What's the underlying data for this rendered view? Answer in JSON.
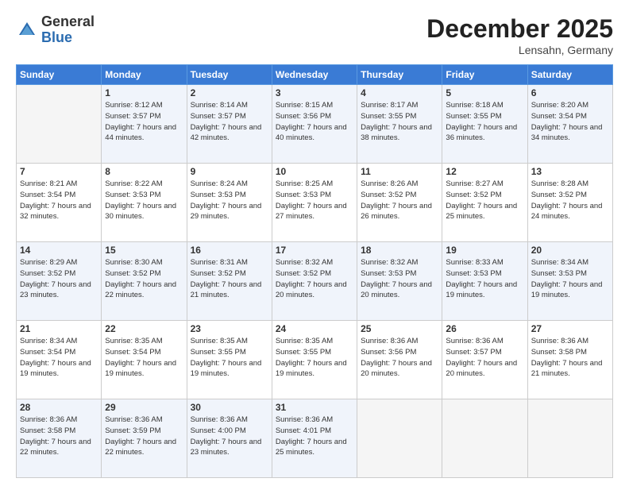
{
  "header": {
    "logo_general": "General",
    "logo_blue": "Blue",
    "month_title": "December 2025",
    "subtitle": "Lensahn, Germany"
  },
  "days_of_week": [
    "Sunday",
    "Monday",
    "Tuesday",
    "Wednesday",
    "Thursday",
    "Friday",
    "Saturday"
  ],
  "weeks": [
    [
      {
        "day": "",
        "info": ""
      },
      {
        "day": "1",
        "info": "Sunrise: 8:12 AM\nSunset: 3:57 PM\nDaylight: 7 hours\nand 44 minutes."
      },
      {
        "day": "2",
        "info": "Sunrise: 8:14 AM\nSunset: 3:57 PM\nDaylight: 7 hours\nand 42 minutes."
      },
      {
        "day": "3",
        "info": "Sunrise: 8:15 AM\nSunset: 3:56 PM\nDaylight: 7 hours\nand 40 minutes."
      },
      {
        "day": "4",
        "info": "Sunrise: 8:17 AM\nSunset: 3:55 PM\nDaylight: 7 hours\nand 38 minutes."
      },
      {
        "day": "5",
        "info": "Sunrise: 8:18 AM\nSunset: 3:55 PM\nDaylight: 7 hours\nand 36 minutes."
      },
      {
        "day": "6",
        "info": "Sunrise: 8:20 AM\nSunset: 3:54 PM\nDaylight: 7 hours\nand 34 minutes."
      }
    ],
    [
      {
        "day": "7",
        "info": "Sunrise: 8:21 AM\nSunset: 3:54 PM\nDaylight: 7 hours\nand 32 minutes."
      },
      {
        "day": "8",
        "info": "Sunrise: 8:22 AM\nSunset: 3:53 PM\nDaylight: 7 hours\nand 30 minutes."
      },
      {
        "day": "9",
        "info": "Sunrise: 8:24 AM\nSunset: 3:53 PM\nDaylight: 7 hours\nand 29 minutes."
      },
      {
        "day": "10",
        "info": "Sunrise: 8:25 AM\nSunset: 3:53 PM\nDaylight: 7 hours\nand 27 minutes."
      },
      {
        "day": "11",
        "info": "Sunrise: 8:26 AM\nSunset: 3:52 PM\nDaylight: 7 hours\nand 26 minutes."
      },
      {
        "day": "12",
        "info": "Sunrise: 8:27 AM\nSunset: 3:52 PM\nDaylight: 7 hours\nand 25 minutes."
      },
      {
        "day": "13",
        "info": "Sunrise: 8:28 AM\nSunset: 3:52 PM\nDaylight: 7 hours\nand 24 minutes."
      }
    ],
    [
      {
        "day": "14",
        "info": "Sunrise: 8:29 AM\nSunset: 3:52 PM\nDaylight: 7 hours\nand 23 minutes."
      },
      {
        "day": "15",
        "info": "Sunrise: 8:30 AM\nSunset: 3:52 PM\nDaylight: 7 hours\nand 22 minutes."
      },
      {
        "day": "16",
        "info": "Sunrise: 8:31 AM\nSunset: 3:52 PM\nDaylight: 7 hours\nand 21 minutes."
      },
      {
        "day": "17",
        "info": "Sunrise: 8:32 AM\nSunset: 3:52 PM\nDaylight: 7 hours\nand 20 minutes."
      },
      {
        "day": "18",
        "info": "Sunrise: 8:32 AM\nSunset: 3:53 PM\nDaylight: 7 hours\nand 20 minutes."
      },
      {
        "day": "19",
        "info": "Sunrise: 8:33 AM\nSunset: 3:53 PM\nDaylight: 7 hours\nand 19 minutes."
      },
      {
        "day": "20",
        "info": "Sunrise: 8:34 AM\nSunset: 3:53 PM\nDaylight: 7 hours\nand 19 minutes."
      }
    ],
    [
      {
        "day": "21",
        "info": "Sunrise: 8:34 AM\nSunset: 3:54 PM\nDaylight: 7 hours\nand 19 minutes."
      },
      {
        "day": "22",
        "info": "Sunrise: 8:35 AM\nSunset: 3:54 PM\nDaylight: 7 hours\nand 19 minutes."
      },
      {
        "day": "23",
        "info": "Sunrise: 8:35 AM\nSunset: 3:55 PM\nDaylight: 7 hours\nand 19 minutes."
      },
      {
        "day": "24",
        "info": "Sunrise: 8:35 AM\nSunset: 3:55 PM\nDaylight: 7 hours\nand 19 minutes."
      },
      {
        "day": "25",
        "info": "Sunrise: 8:36 AM\nSunset: 3:56 PM\nDaylight: 7 hours\nand 20 minutes."
      },
      {
        "day": "26",
        "info": "Sunrise: 8:36 AM\nSunset: 3:57 PM\nDaylight: 7 hours\nand 20 minutes."
      },
      {
        "day": "27",
        "info": "Sunrise: 8:36 AM\nSunset: 3:58 PM\nDaylight: 7 hours\nand 21 minutes."
      }
    ],
    [
      {
        "day": "28",
        "info": "Sunrise: 8:36 AM\nSunset: 3:58 PM\nDaylight: 7 hours\nand 22 minutes."
      },
      {
        "day": "29",
        "info": "Sunrise: 8:36 AM\nSunset: 3:59 PM\nDaylight: 7 hours\nand 22 minutes."
      },
      {
        "day": "30",
        "info": "Sunrise: 8:36 AM\nSunset: 4:00 PM\nDaylight: 7 hours\nand 23 minutes."
      },
      {
        "day": "31",
        "info": "Sunrise: 8:36 AM\nSunset: 4:01 PM\nDaylight: 7 hours\nand 25 minutes."
      },
      {
        "day": "",
        "info": ""
      },
      {
        "day": "",
        "info": ""
      },
      {
        "day": "",
        "info": ""
      }
    ]
  ]
}
